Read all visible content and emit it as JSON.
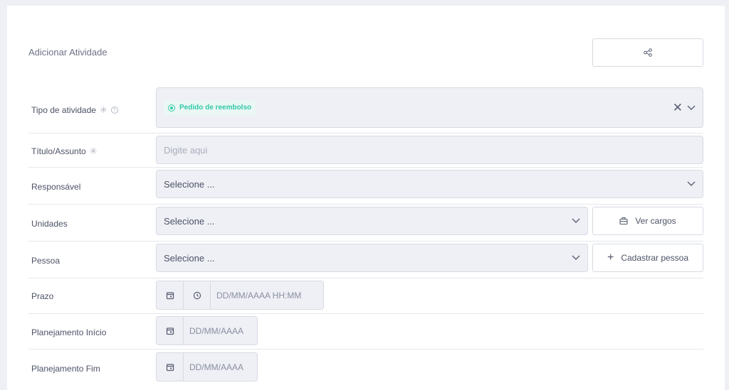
{
  "header": {
    "title": "Adicionar Atividade",
    "share_icon": "share-icon"
  },
  "form": {
    "tipo": {
      "label": "Tipo de atividade",
      "tag_label": "Pedido de reembolso",
      "tag_color": "#33c9a6"
    },
    "titulo": {
      "label": "Título/Assunto",
      "placeholder": "Digite aqui"
    },
    "responsavel": {
      "label": "Responsável",
      "value": "Selecione ..."
    },
    "unidades": {
      "label": "Unidades",
      "value": "Selecione ...",
      "button_label": "Ver cargos"
    },
    "pessoa": {
      "label": "Pessoa",
      "value": "Selecione ...",
      "button_label": "Cadastrar pessoa"
    },
    "prazo": {
      "label": "Prazo",
      "placeholder": "DD/MM/AAAA HH:MM"
    },
    "planejamento_inicio": {
      "label": "Planejamento Início",
      "placeholder": "DD/MM/AAAA"
    },
    "planejamento_fim": {
      "label": "Planejamento Fim",
      "placeholder": "DD/MM/AAAA"
    }
  }
}
